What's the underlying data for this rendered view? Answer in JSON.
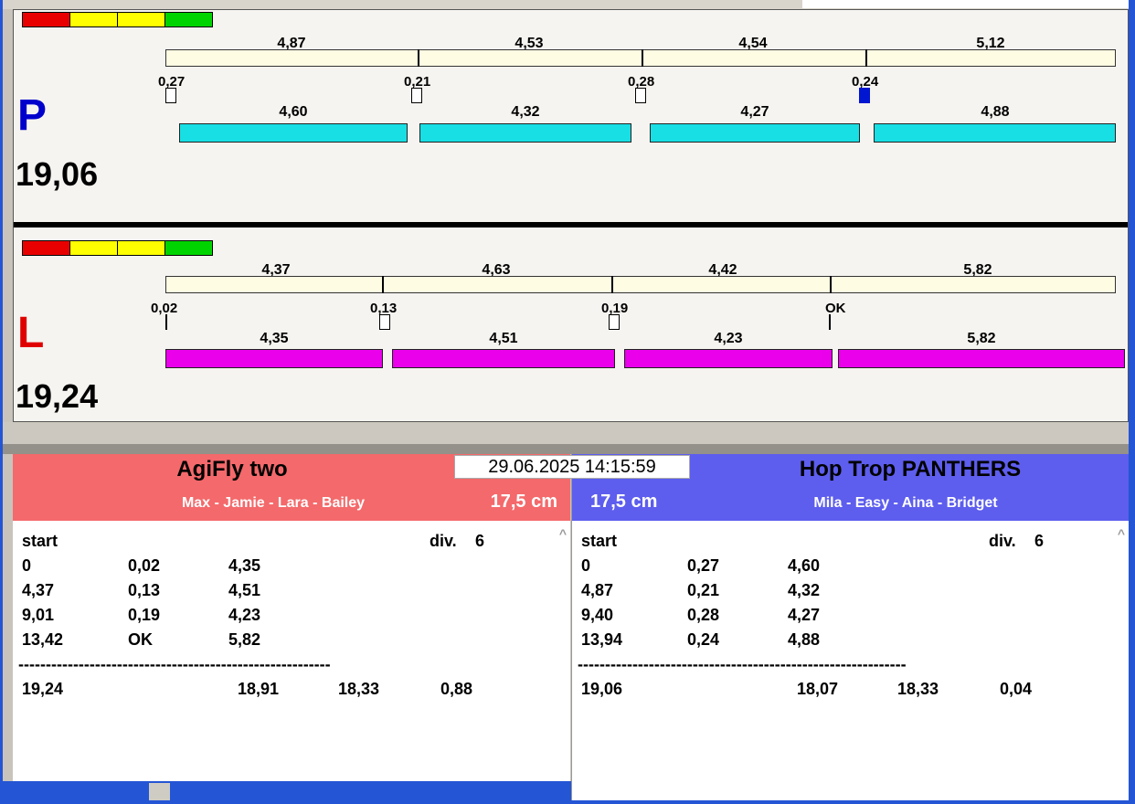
{
  "ui": {
    "datetime": "29.06.2025 14:15:59",
    "scroll_up_glyph": "^"
  },
  "colors": {
    "right_lane_bar": "#17dfe4",
    "left_lane_bar": "#ea00ea",
    "right_lane_letter": "#0000cd",
    "left_lane_letter": "#e00000",
    "team_left_header": "#f4696b",
    "team_right_header": "#5d5dee",
    "traffic_red": "#e80000",
    "traffic_yellow": "#ffff00",
    "traffic_green": "#00d400",
    "change_filled_box": "#0016d0",
    "taskbar_blue": "#2455d4",
    "timeline_bar": "#fffce4"
  },
  "lanes": [
    {
      "letter": "P",
      "total": "19,06",
      "top_splits": [
        "4,87",
        "4,53",
        "4,54",
        "5,12"
      ],
      "changes": [
        {
          "value": "0,27",
          "marker": "box"
        },
        {
          "value": "0,21",
          "marker": "box"
        },
        {
          "value": "0,28",
          "marker": "box"
        },
        {
          "value": "0,24",
          "marker": "box-filled"
        }
      ],
      "bottom_splits": [
        "4,60",
        "4,32",
        "4,27",
        "4,88"
      ]
    },
    {
      "letter": "L",
      "total": "19,24",
      "top_splits": [
        "4,37",
        "4,63",
        "4,42",
        "5,82"
      ],
      "changes": [
        {
          "value": "0,02",
          "marker": "tick"
        },
        {
          "value": "0,13",
          "marker": "box"
        },
        {
          "value": "0,19",
          "marker": "box"
        },
        {
          "value": "OK",
          "marker": "tick"
        }
      ],
      "bottom_splits": [
        "4,35",
        "4,51",
        "4,23",
        "5,82"
      ]
    }
  ],
  "teams": [
    {
      "name": "AgiFly two",
      "members": "Max - Jamie - Lara - Bailey",
      "jump_height": "17,5 cm",
      "start_label": "start",
      "div_label": "div.",
      "div_value": "6",
      "rows": [
        [
          "0",
          "0,02",
          "4,35"
        ],
        [
          "4,37",
          "0,13",
          "4,51"
        ],
        [
          "9,01",
          "0,19",
          "4,23"
        ],
        [
          "13,42",
          "OK",
          "5,82"
        ]
      ],
      "separator": "---------------------------------------------------------",
      "totals": [
        "19,24",
        "18,91",
        "18,33",
        "0,88"
      ]
    },
    {
      "name": "Hop Trop PANTHERS",
      "members": "Mila - Easy - Aina - Bridget",
      "jump_height": "17,5 cm",
      "start_label": "start",
      "div_label": "div.",
      "div_value": "6",
      "rows": [
        [
          "0",
          "0,27",
          "4,60"
        ],
        [
          "4,87",
          "0,21",
          "4,32"
        ],
        [
          "9,40",
          "0,28",
          "4,27"
        ],
        [
          "13,94",
          "0,24",
          "4,88"
        ]
      ],
      "separator": "------------------------------------------------------------",
      "totals": [
        "19,06",
        "18,07",
        "18,33",
        "0,04"
      ]
    }
  ]
}
